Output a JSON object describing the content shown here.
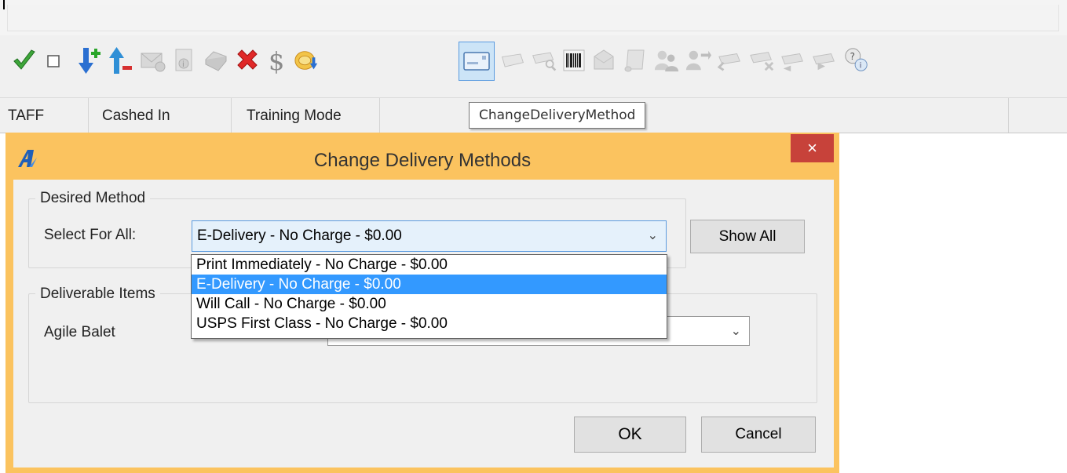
{
  "status_bar": {
    "cells": [
      "TAFF",
      "Cashed In",
      "Training Mode",
      ""
    ]
  },
  "tooltip": "ChangeDeliveryMethod",
  "toolbar": {
    "icons": [
      "check-icon",
      "checkbox-icon",
      "add-down-arrow-icon",
      "remove-up-arrow-icon",
      "envelope-icon",
      "info-document-icon",
      "printer-icon",
      "delete-x-icon",
      "dollar-icon",
      "refund-wallet-icon",
      "change-delivery-method-icon",
      "ticket-icon",
      "ticket-search-icon",
      "barcode-icon",
      "package-icon",
      "scroll-icon",
      "users-icon",
      "user-swap-icon",
      "ticket-arrow-icon",
      "ticket-x-icon",
      "ticket-prev-icon",
      "ticket-next-icon",
      "help-info-icon"
    ]
  },
  "dialog": {
    "title": "Change Delivery Methods",
    "close_label": "×",
    "desired_method": {
      "group_title": "Desired Method",
      "select_label": "Select For All:",
      "selected_value": "E-Delivery - No Charge - $0.00",
      "show_all_label": "Show All"
    },
    "dropdown_options": [
      "Print Immediately - No Charge - $0.00",
      "E-Delivery - No Charge - $0.00",
      "Will Call  - No Charge - $0.00",
      "USPS First Class - No Charge - $0.00"
    ],
    "selected_index": 1,
    "deliverable_items": {
      "group_title": "Deliverable Items",
      "item_label": "Agile Balet",
      "item_value": ""
    },
    "ok_label": "OK",
    "cancel_label": "Cancel"
  },
  "colors": {
    "dialog_frame": "#fbc35f",
    "close_button": "#c7423a",
    "selection": "#3399ff"
  }
}
